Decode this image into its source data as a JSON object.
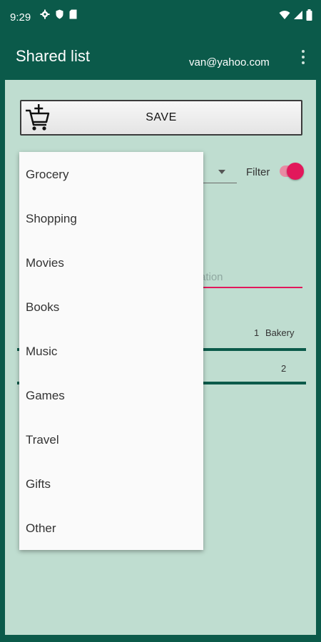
{
  "status_bar": {
    "time": "9:29",
    "icons_left": [
      "settings-icon",
      "shield-icon",
      "sim-icon"
    ],
    "icons_right": [
      "wifi-icon",
      "signal-icon",
      "battery-icon"
    ]
  },
  "app_bar": {
    "title": "Shared list",
    "account": "van@yahoo.com",
    "overflow_icon": "more-vertical-icon"
  },
  "toolbar": {
    "save_label": "SAVE",
    "save_icon": "add-to-cart-icon"
  },
  "filter": {
    "label": "Filter",
    "enabled": true
  },
  "location_field": {
    "visible_hint": "ation"
  },
  "list_rows": [
    {
      "qty": "1",
      "category": "Bakery"
    },
    {
      "qty": "2",
      "category": ""
    }
  ],
  "dropdown": {
    "options": [
      "Grocery",
      "Shopping",
      "Movies",
      "Books",
      "Music",
      "Games",
      "Travel",
      "Gifts",
      "Other"
    ]
  },
  "colors": {
    "primary": "#0b5a4a",
    "background": "#bfddd0",
    "accent": "#e2185b",
    "accent_light": "#e88aa3"
  }
}
